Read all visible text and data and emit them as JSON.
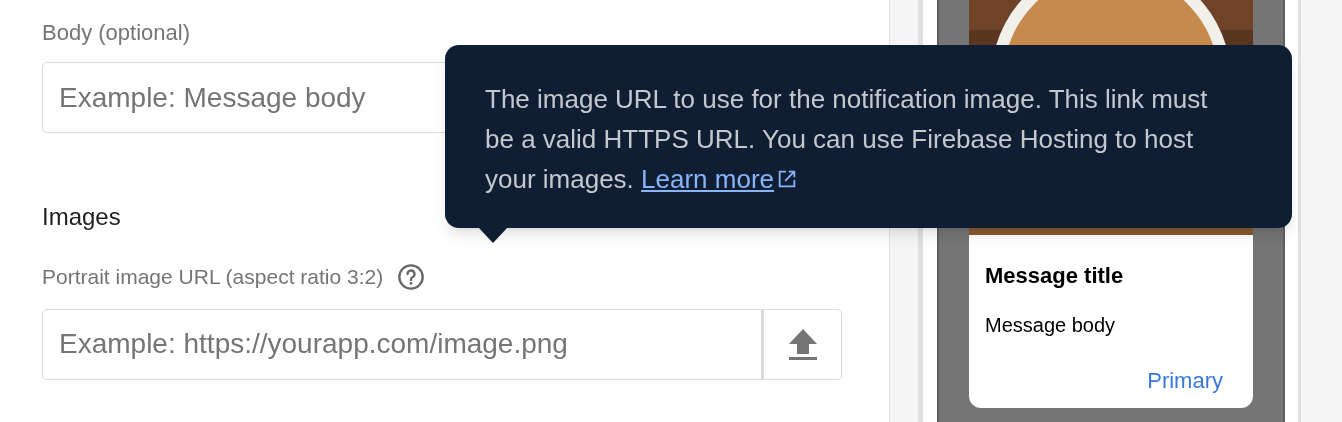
{
  "body_field": {
    "label": "Body (optional)",
    "placeholder": "Example: Message body"
  },
  "images": {
    "heading": "Images",
    "portrait_field": {
      "label": "Portrait image URL (aspect ratio 3:2)",
      "placeholder": "Example: https://yourapp.com/image.png"
    }
  },
  "tooltip": {
    "text": "The image URL to use for the notification image. This link must be a valid HTTPS URL. You can use Firebase Hosting to host your images.",
    "link": "Learn more"
  },
  "preview": {
    "title": "Message title",
    "body": "Message body",
    "action": "Primary"
  }
}
